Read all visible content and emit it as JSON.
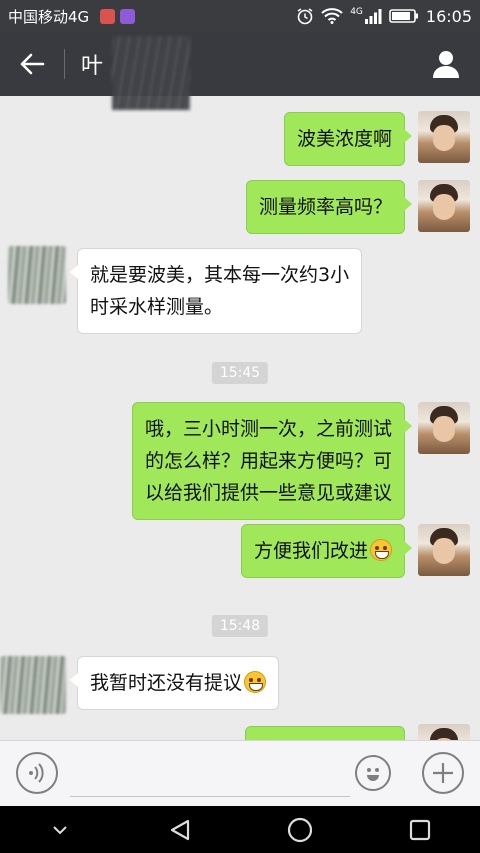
{
  "status_bar": {
    "carrier": "中国移动4G",
    "network_badge": "4G",
    "time": "16:05"
  },
  "title_bar": {
    "title": "叶"
  },
  "messages": [
    {
      "side": "self",
      "text": "波美浓度啊"
    },
    {
      "side": "self",
      "text": "测量频率高吗？"
    },
    {
      "side": "other",
      "lines": [
        "就是要波美，其本每一次约3小",
        "时采水样测量。"
      ]
    },
    {
      "type": "timestamp",
      "text": "15:45"
    },
    {
      "side": "self",
      "lines": [
        "哦，三小时测一次，之前测试",
        "的怎么样？用起来方便吗？可",
        "以给我们提供一些意见或建议"
      ]
    },
    {
      "side": "self",
      "text": "方便我们改进",
      "emoji": "grin-emoji"
    },
    {
      "type": "timestamp",
      "text": "15:48"
    },
    {
      "side": "other",
      "text": "我暂时还没有提议",
      "emoji": "grin-emoji"
    }
  ],
  "input_bar": {
    "voice_icon": "voice-icon",
    "emoji_icon": "smile-icon",
    "add_icon": "plus-icon",
    "value": ""
  },
  "nav_bar": {
    "icons": [
      "chevron-down-icon",
      "back-triangle-icon",
      "home-circle-icon",
      "recents-square-icon"
    ]
  },
  "colors": {
    "chat_bg": "#ebebeb",
    "self_bubble": "#a0e75a",
    "other_bubble": "#ffffff",
    "title_bar": "#393a3f",
    "status_bar": "#3b3c40"
  }
}
